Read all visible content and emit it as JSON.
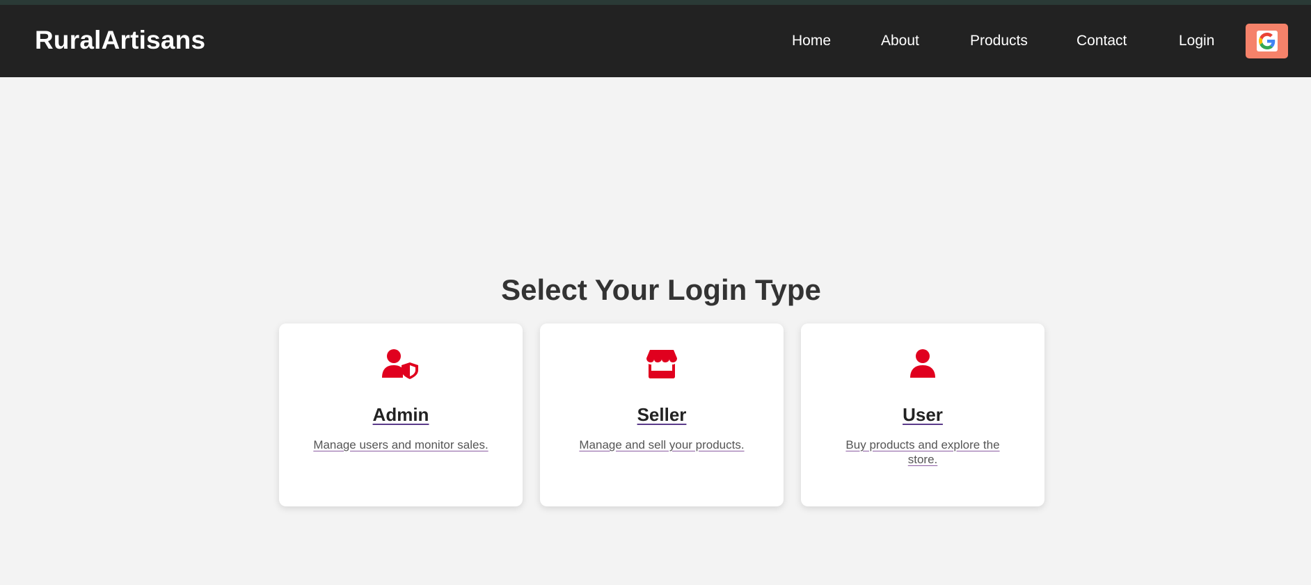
{
  "header": {
    "brand": "RuralArtisans",
    "nav": [
      {
        "label": "Home"
      },
      {
        "label": "About"
      },
      {
        "label": "Products"
      },
      {
        "label": "Contact"
      },
      {
        "label": "Login"
      }
    ],
    "google_button_icon": "google-icon"
  },
  "main": {
    "title": "Select Your Login Type",
    "cards": [
      {
        "icon": "admin-shield-icon",
        "title": "Admin",
        "description": "Manage users and monitor sales."
      },
      {
        "icon": "store-icon",
        "title": "Seller",
        "description": "Manage and sell your products."
      },
      {
        "icon": "user-icon",
        "title": "User",
        "description": "Buy products and explore the store."
      }
    ]
  },
  "colors": {
    "navbar": "#222222",
    "accent_icon": "#e0001e",
    "google_button": "#f5826a",
    "background": "#f3f3f3"
  }
}
